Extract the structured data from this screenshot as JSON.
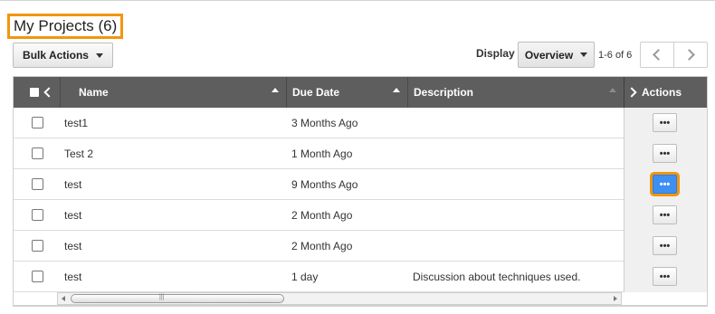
{
  "page": {
    "title": "My Projects (6)"
  },
  "toolbar": {
    "bulk_actions_label": "Bulk Actions",
    "display_label": "Display",
    "display_value": "Overview",
    "pager_text": "1-6 of 6"
  },
  "table": {
    "columns": {
      "name": "Name",
      "due_date": "Due Date",
      "description": "Description",
      "actions": "Actions"
    },
    "rows": [
      {
        "name": "test1",
        "due": "3 Months Ago",
        "description": ""
      },
      {
        "name": "Test 2",
        "due": "1 Month Ago",
        "description": ""
      },
      {
        "name": "test",
        "due": "9 Months Ago",
        "description": ""
      },
      {
        "name": "test",
        "due": "2 Month Ago",
        "description": ""
      },
      {
        "name": "test",
        "due": "2 Month Ago",
        "description": ""
      },
      {
        "name": "test",
        "due": "1 day",
        "description": "Discussion about techniques used."
      }
    ],
    "row_action_label": "•••",
    "active_action_row": 2
  },
  "colors": {
    "header_bg": "#5e5e5e",
    "highlight": "#f0960f",
    "active_button": "#3e8ff2"
  },
  "icons": [
    "caret-down-icon",
    "chevron-left-icon",
    "chevron-right-icon",
    "sort-asc-icon",
    "more-dots-icon"
  ]
}
